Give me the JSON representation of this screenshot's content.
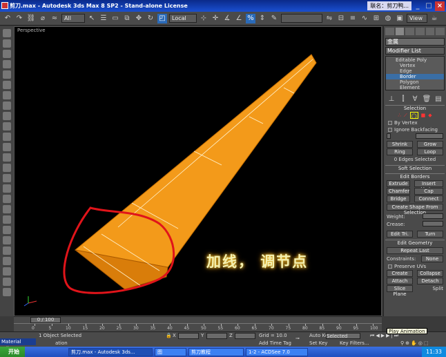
{
  "window": {
    "title": "剪刀.max - Autodesk 3ds Max 8 SP2 - Stand-alone License",
    "ime_text": "联名：剪刀鸭...",
    "menu_view": "View"
  },
  "toolbar": {
    "filter_select": "All",
    "coord_system": "Local"
  },
  "viewport": {
    "label": "Perspective",
    "annotation_text": "加线， 调节点"
  },
  "command_panel": {
    "object_name": "金属",
    "modifier_list": "Modifier List",
    "stack": [
      "Editable Poly",
      "Vertex",
      "Edge",
      "Border",
      "Polygon",
      "Element"
    ],
    "selected_stack_item": "Border",
    "selection": {
      "title": "Selection",
      "by_vertex": "By Vertex",
      "ignore_backfacing": "Ignore Backfacing",
      "shrink": "Shrink",
      "grow": "Grow",
      "ring": "Ring",
      "loop": "Loop",
      "status": "0 Edges Selected"
    },
    "soft_selection": "Soft Selection",
    "edit_borders": {
      "title": "Edit Borders",
      "extrude": "Extrude",
      "insert_vertex": "Insert Vertex",
      "chamfer": "Chamfer",
      "cap": "Cap",
      "bridge": "Bridge",
      "connect": "Connect",
      "create_shape": "Create Shape From Selection",
      "weight": "Weight:",
      "crease": "Crease:",
      "edit_tri": "Edit Tri.",
      "turn": "Turn"
    },
    "edit_geometry": {
      "title": "Edit Geometry",
      "repeat_last": "Repeat Last",
      "constraints": "Constraints:",
      "constraints_value": "None",
      "preserve_uvs": "Preserve UVs",
      "create": "Create",
      "collapse": "Collapse",
      "attach": "Attach",
      "detach": "Detach",
      "slice_plane": "Slice Plane",
      "split": "Split"
    }
  },
  "timeline": {
    "frame_range": "0 / 100",
    "ticks": [
      "0",
      "5",
      "10",
      "15",
      "20",
      "25",
      "30",
      "35",
      "40",
      "45",
      "50",
      "55",
      "60",
      "65",
      "70",
      "75",
      "80",
      "85",
      "90",
      "95",
      "100"
    ]
  },
  "statusbar": {
    "selection_status": "1 Object Selected",
    "prompt": "ation",
    "x_label": "X",
    "y_label": "Y",
    "z_label": "Z",
    "grid": "Grid = 10.0",
    "add_time_tag": "Add Time Tag",
    "auto_key": "Auto Key",
    "auto_key_value": "Selected",
    "set_key": "Set Key",
    "key_filters": "Key Filters..."
  },
  "material_editor": "Material Edit...",
  "tooltip": "Play Animation",
  "taskbar": {
    "start": "开始",
    "tasks": [
      "剪刀.max - Autodesk 3ds...",
      "图",
      "剪刀教程",
      "1-2 - ACDSee 7.0"
    ],
    "clock": "11:33"
  },
  "colors": {
    "model_orange": "#f39a1a",
    "annotation_red": "#e0141a",
    "selection_blue": "#3a6ea5"
  }
}
